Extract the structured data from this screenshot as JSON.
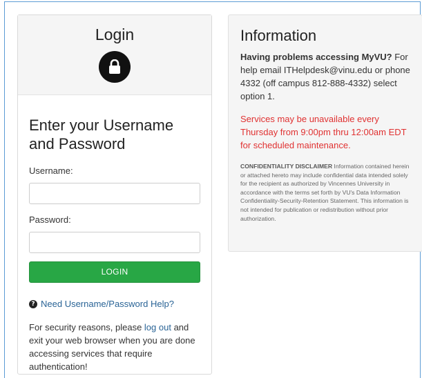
{
  "login": {
    "title": "Login",
    "lock_icon": "lock-icon",
    "heading": "Enter your Username and Password",
    "username_label": "Username:",
    "username_value": "",
    "username_placeholder": "",
    "password_label": "Password:",
    "password_value": "",
    "password_placeholder": "",
    "login_button": "LOGIN",
    "help_icon": "question-circle-icon",
    "help_link": "Need Username/Password Help?",
    "security_prefix": "For security reasons, please ",
    "security_link": "log out",
    "security_suffix": " and exit your web browser when you are done accessing services that require authentication!"
  },
  "info": {
    "title": "Information",
    "problems_bold": "Having problems accessing MyVU?",
    "problems_text": " For help email ITHelpdesk@vinu.edu or phone 4332 (off campus 812-888-4332) select option 1.",
    "maintenance": "Services may be unavailable every Thursday from 9:00pm thru 12:00am EDT for scheduled maintenance.",
    "disclaimer_bold": "CONFIDENTIALITY DISCLAIMER",
    "disclaimer_text": " Information contained herein or attached hereto may include confidential data intended solely for the recipient as authorized by Vincennes University in accordance with the terms set forth by VU's Data Information Confidentiality-Security-Retention Statement. This information is not intended for publication or redistribution without prior authorization."
  },
  "colors": {
    "login_button": "#28a745",
    "link": "#2a6496",
    "maintenance_text": "#e03131",
    "panel_background": "#f5f5f5"
  }
}
